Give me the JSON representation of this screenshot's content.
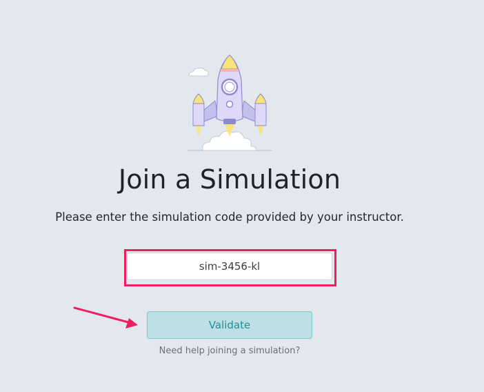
{
  "page": {
    "title": "Join a Simulation",
    "subtitle": "Please enter the simulation code provided by your instructor."
  },
  "code_input": {
    "value": "sim-3456-kl"
  },
  "validate_button": {
    "label": "Validate"
  },
  "help_link": {
    "label": "Need help joining a simulation?"
  },
  "colors": {
    "background": "#e3e7ee",
    "highlight": "#ee1f5f",
    "button_bg": "#bde0e4",
    "button_text": "#1f8f96"
  },
  "icons": {
    "illustration": "rocket-launch-icon",
    "pointer": "arrow-pointer-icon"
  }
}
